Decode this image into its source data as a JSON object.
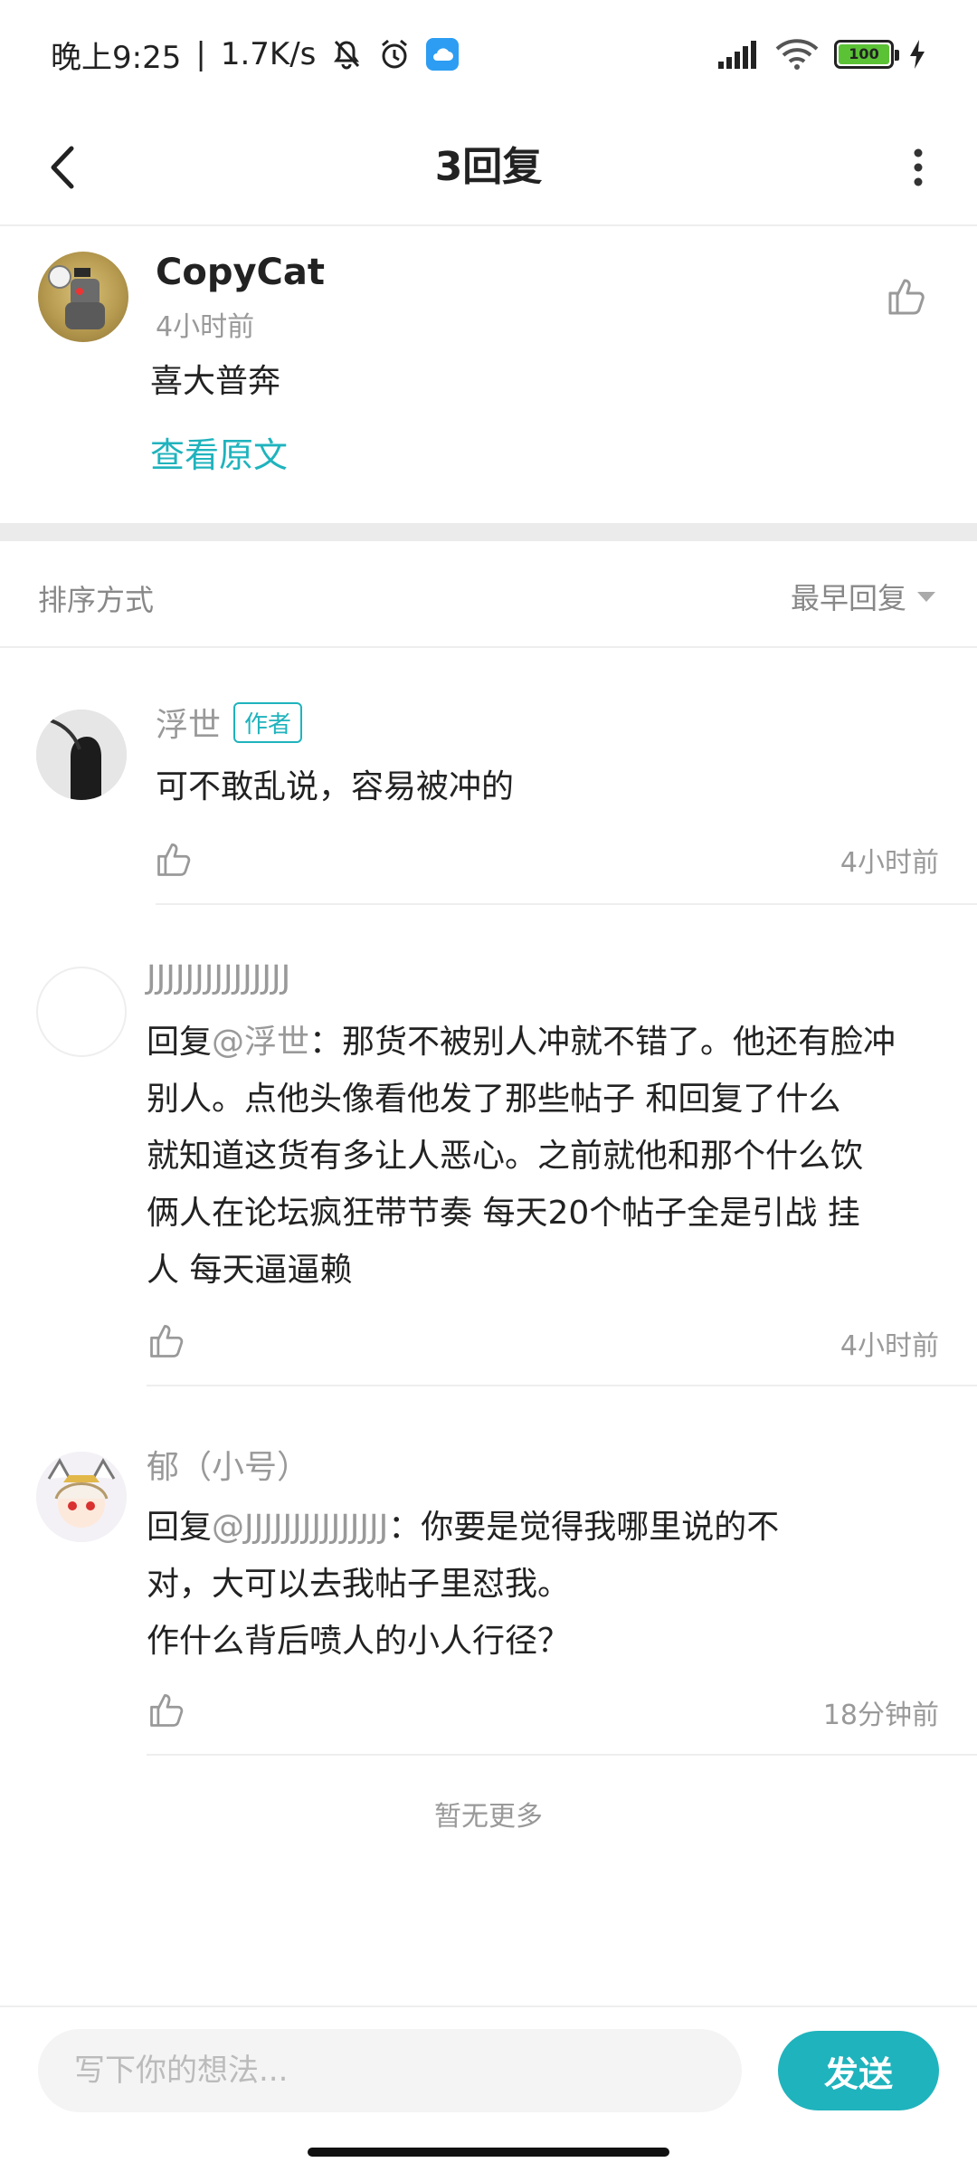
{
  "status_bar": {
    "time": "晚上9:25",
    "separator": "|",
    "net_speed": "1.7K/s",
    "battery": "100"
  },
  "header": {
    "title": "3回复"
  },
  "original_post": {
    "author": "CopyCat",
    "time": "4小时前",
    "content": "喜大普奔",
    "view_original": "查看原文"
  },
  "sort": {
    "label": "排序方式",
    "selected": "最早回复"
  },
  "replies": [
    {
      "author": "浮世",
      "badge": "作者",
      "content": "可不敢乱说，容易被冲的",
      "time": "4小时前"
    },
    {
      "author": "JJJJJJJJJJJJJJJ",
      "reply_prefix": "回复",
      "mention": "@浮世",
      "lines": [
        "：那货不被别人冲就不错了。他还有脸冲",
        "别人。点他头像看他发了那些帖子 和回复了什么",
        "就知道这货有多让人恶心。之前就他和那个什么饮",
        "俩人在论坛疯狂带节奏 每天20个帖子全是引战 挂",
        "人 每天逼逼赖"
      ],
      "time": "4小时前"
    },
    {
      "author": "郁（小号）",
      "reply_prefix": "回复",
      "mention": "@JJJJJJJJJJJJJJJ",
      "lines": [
        "：你要是觉得我哪里说的不",
        "对，大可以去我帖子里怼我。",
        "作什么背后喷人的小人行径？"
      ],
      "time": "18分钟前"
    }
  ],
  "no_more": "暂无更多",
  "compose": {
    "placeholder": "写下你的想法...",
    "send": "发送"
  },
  "colors": {
    "accent": "#1fb3bd",
    "muted_text": "#999999",
    "divider": "#eeeeee"
  }
}
